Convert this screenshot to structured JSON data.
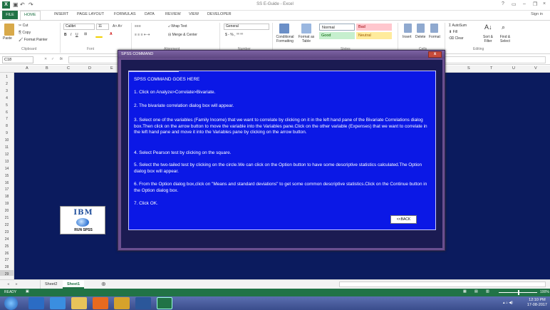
{
  "window": {
    "title": "SS E-Guide - Excel",
    "signin": "Sign in"
  },
  "tabs": [
    "FILE",
    "HOME",
    "INSERT",
    "PAGE LAYOUT",
    "FORMULAS",
    "DATA",
    "REVIEW",
    "VIEW",
    "DEVELOPER"
  ],
  "ribbon": {
    "clipboard": {
      "paste": "Paste",
      "cut": "Cut",
      "copy": "Copy",
      "format_painter": "Format Painter",
      "label": "Clipboard"
    },
    "font": {
      "name": "Calibri",
      "size": "11",
      "label": "Font"
    },
    "alignment": {
      "wrap": "Wrap Text",
      "merge": "Merge & Center",
      "label": "Alignment"
    },
    "number": {
      "format": "General",
      "label": "Number"
    },
    "styles": {
      "conditional": "Conditional Formatting",
      "format_as": "Format as Table",
      "normal": "Normal",
      "bad": "Bad",
      "good": "Good",
      "neutral": "Neutral",
      "label": "Styles"
    },
    "cells": {
      "insert": "Insert",
      "delete": "Delete",
      "format": "Format",
      "label": "Cells"
    },
    "editing": {
      "autosum": "AutoSum",
      "fill": "Fill",
      "clear": "Clear",
      "sort": "Sort & Filter",
      "find": "Find & Select",
      "label": "Editing"
    }
  },
  "formula_bar": {
    "name_box": "C18",
    "fx": "fx"
  },
  "columns": [
    "A",
    "B",
    "C",
    "D",
    "E",
    "S",
    "T",
    "U",
    "V"
  ],
  "rows": [
    "1",
    "2",
    "3",
    "4",
    "5",
    "6",
    "7",
    "8",
    "9",
    "10",
    "11",
    "12",
    "13",
    "14",
    "15",
    "16",
    "17",
    "18",
    "19",
    "20",
    "21",
    "22",
    "23",
    "24",
    "25",
    "26",
    "27",
    "28",
    "29"
  ],
  "ibm_button": {
    "logo": "IBM",
    "caption": "RUN SPSS"
  },
  "dialog": {
    "title": "SPSS COMMAND",
    "close": "x",
    "heading": "SPSS COMMAND GOES HERE",
    "steps": [
      "1. Click on Analyze>Correlate>Bivariate.",
      "2. The bivariate correlation dialog box will appear.",
      "3. Select one of the variables (Family Income) that we want to correlate by clicking on it in the left hand pane of the Bivariate Correlations dialog box.Then click on the arrow button to move the variable into the Variables pane.Click on the other variable (Expenses) that we want to correlate in the left hand pane and move it into the Variables pane by clicking on the arrow button.",
      "4. Select Pearson test by clicking on the square.",
      "5. Select the two-tailed test by clicking on the circle.We can click on the Option button to have some descriptive statistics calculated.The Option dialog box will appear.",
      "6. From the Option dialog box,click on \"Means and standard deviations\" to get some common descriptive statistics.Click on the Continue button in the Option dialog box.",
      "7. Click OK."
    ],
    "back_button": "<<BACK"
  },
  "sheet_tabs": [
    "Sheet2",
    "Sheet1"
  ],
  "status": {
    "ready": "READY",
    "zoom": "100%"
  },
  "taskbar": {
    "time": "12:10 PM",
    "date": "17-08-2017"
  },
  "colors": {
    "excel_green": "#217346",
    "panel_blue": "#0b18e6",
    "dialog_purple": "#6a4f8f"
  }
}
